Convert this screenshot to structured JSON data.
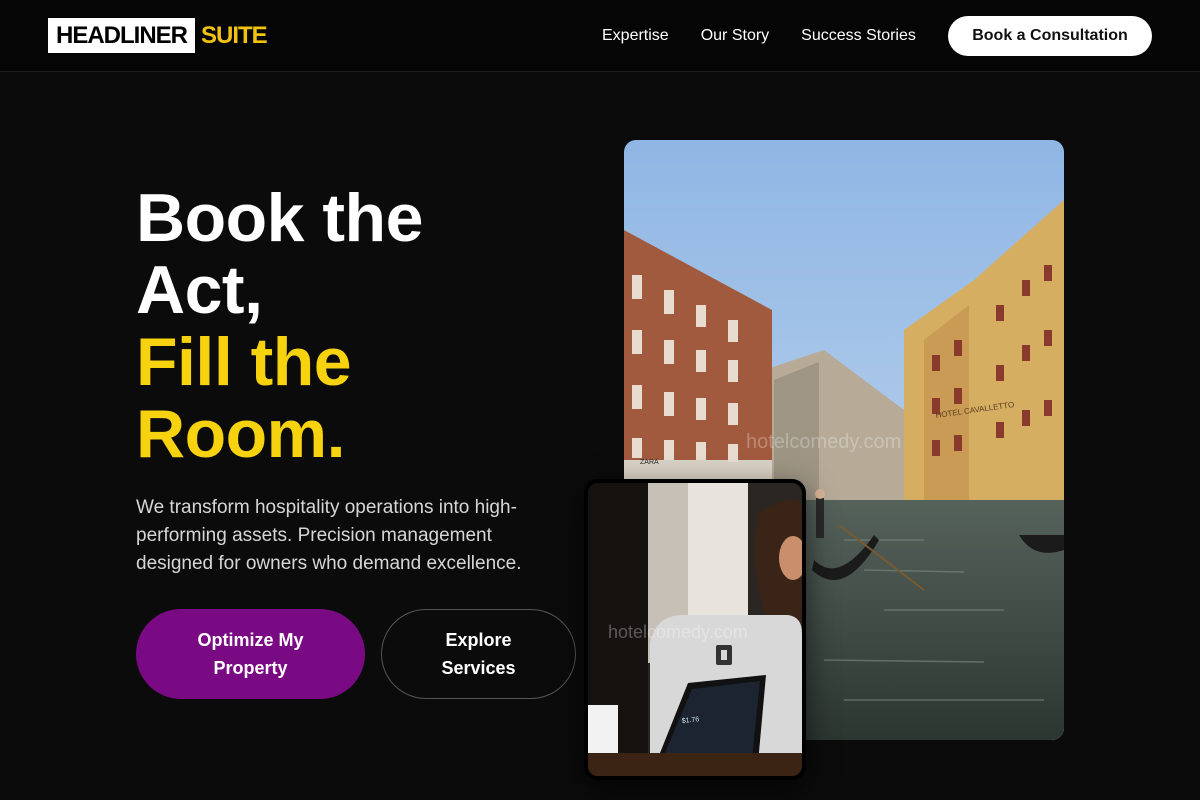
{
  "header": {
    "logo_text": "HEADLINER",
    "logo_accent": "SUITE",
    "nav": [
      "Expertise",
      "Our Story",
      "Success Stories"
    ],
    "cta": "Book a Consultation"
  },
  "hero": {
    "headline_lines": [
      "Book the",
      "Act,"
    ],
    "headline_accent_lines": [
      "Fill the",
      "Room."
    ],
    "subtitle": "We transform hospitality operations into high-performing assets. Precision management designed for owners who demand excellence.",
    "primary_button": "Optimize My Property",
    "secondary_button": "Explore Services"
  },
  "images": {
    "main_watermark": "hotelcomedy.com",
    "overlay_watermark": "hotelcomedy.com",
    "hotel_sign": "HOTEL CAVALLETTO",
    "shop_sign": "ZARA",
    "pos_amount": "$1.76"
  },
  "colors": {
    "accent_yellow": "#f7d20e",
    "primary_purple": "#7a0a84",
    "background": "#0b0b0b"
  }
}
